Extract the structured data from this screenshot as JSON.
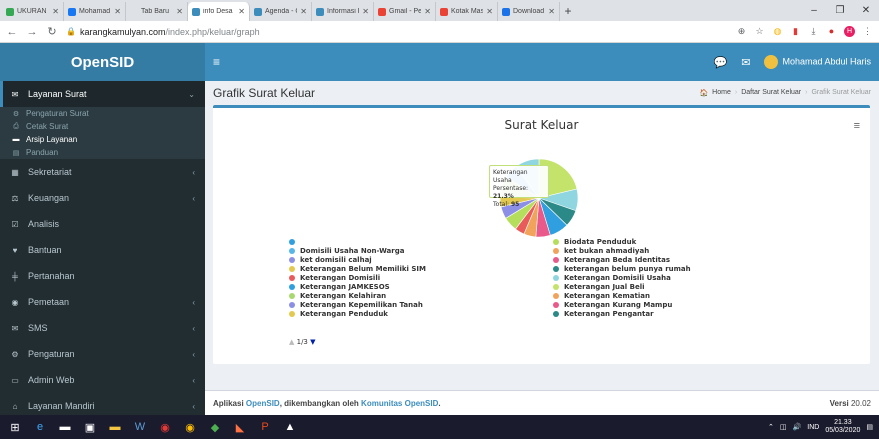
{
  "browser": {
    "tabs": [
      {
        "label": "UKURAN P",
        "color": "#34a853",
        "active": false
      },
      {
        "label": "Mohamad",
        "color": "#1877f2",
        "active": false
      },
      {
        "label": "Tab Baru",
        "color": "#dee1e6",
        "active": false
      },
      {
        "label": "info Desa",
        "color": "#3c8dbc",
        "active": true
      },
      {
        "label": "Agenda - C",
        "color": "#3c8dbc",
        "active": false
      },
      {
        "label": "Informasi P",
        "color": "#3c8dbc",
        "active": false
      },
      {
        "label": "Gmail - Per",
        "color": "#ea4335",
        "active": false
      },
      {
        "label": "Kotak Mas",
        "color": "#ea4335",
        "active": false
      },
      {
        "label": "Download",
        "color": "#1a73e8",
        "active": false
      }
    ],
    "url_host": "karangkamulyan.com",
    "url_path": "/index.php/keluar/graph"
  },
  "app": {
    "logo": "OpenSID",
    "user_name": "Mohamad Abdul Haris"
  },
  "sidebar": {
    "items": [
      {
        "label": "Layanan Surat",
        "icon": "envelope-icon",
        "glyph": "✉",
        "active": true,
        "chevron": "⌄"
      },
      {
        "label": "Sekretariat",
        "icon": "archive-icon",
        "glyph": "▦",
        "chevron": "‹"
      },
      {
        "label": "Keuangan",
        "icon": "balance-icon",
        "glyph": "⚖",
        "chevron": "‹"
      },
      {
        "label": "Analisis",
        "icon": "chart-icon",
        "glyph": "☑",
        "chevron": ""
      },
      {
        "label": "Bantuan",
        "icon": "heart-icon",
        "glyph": "♥",
        "chevron": ""
      },
      {
        "label": "Pertanahan",
        "icon": "land-icon",
        "glyph": "╪",
        "chevron": ""
      },
      {
        "label": "Pemetaan",
        "icon": "globe-icon",
        "glyph": "◉",
        "chevron": "‹"
      },
      {
        "label": "SMS",
        "icon": "sms-icon",
        "glyph": "✉",
        "chevron": "‹"
      },
      {
        "label": "Pengaturan",
        "icon": "users-icon",
        "glyph": "⚙",
        "chevron": "‹"
      },
      {
        "label": "Admin Web",
        "icon": "desktop-icon",
        "glyph": "▭",
        "chevron": "‹"
      },
      {
        "label": "Layanan Mandiri",
        "icon": "laptop-icon",
        "glyph": "⌂",
        "chevron": "‹"
      }
    ],
    "subitems": [
      {
        "label": "Pengaturan Surat",
        "glyph": "⚙",
        "active": false
      },
      {
        "label": "Cetak Surat",
        "glyph": "⎙",
        "active": false
      },
      {
        "label": "Arsip Layanan",
        "glyph": "▬",
        "active": true
      },
      {
        "label": "Panduan",
        "glyph": "▤",
        "active": false
      }
    ]
  },
  "content": {
    "title": "Grafik Surat Keluar",
    "breadcrumb": [
      "Home",
      "Daftar Surat Keluar",
      "Grafik Surat Keluar"
    ]
  },
  "tooltip": {
    "name": "Keterangan Usaha",
    "pct_label": "Persentase: ",
    "pct": "21.3%",
    "total_label": "Total: ",
    "total": "95"
  },
  "pager": {
    "text": "1/3"
  },
  "footer": {
    "prefix": "Aplikasi ",
    "app": "OpenSID",
    "middle": ", dikembangkan oleh ",
    "community": "Komunitas OpenSID",
    "suffix": ".",
    "version_label": "Versi ",
    "version": "20.02"
  },
  "taskbar": {
    "lang": "IND",
    "time": "21.33",
    "date": "05/03/2020"
  },
  "chart_data": {
    "type": "pie",
    "title": "Surat Keluar",
    "legend_left": [
      {
        "name": "",
        "color": "#2f9fe0"
      },
      {
        "name": "Domisili Usaha Non-Warga",
        "color": "#56b6e9"
      },
      {
        "name": "ket domisili calhaj",
        "color": "#8b8fe6"
      },
      {
        "name": "Keterangan Belum Memiliki SIM",
        "color": "#e3c94f"
      },
      {
        "name": "Keterangan Domisili",
        "color": "#e95a5a"
      },
      {
        "name": "Keterangan JAMKESOS",
        "color": "#2f9fe0"
      },
      {
        "name": "Keterangan Kelahiran",
        "color": "#a8d86e"
      },
      {
        "name": "Keterangan Kepemilikan Tanah",
        "color": "#8b8fe6"
      },
      {
        "name": "Keterangan Penduduk",
        "color": "#e3c94f"
      }
    ],
    "legend_right": [
      {
        "name": "Biodata Penduduk",
        "color": "#b5de5c"
      },
      {
        "name": "ket bukan ahmadiyah",
        "color": "#f1a35b"
      },
      {
        "name": "Keterangan Beda Identitas",
        "color": "#e95a8a"
      },
      {
        "name": "keterangan belum punya rumah",
        "color": "#2b8a88"
      },
      {
        "name": "Keterangan Domisili Usaha",
        "color": "#8fd6e0"
      },
      {
        "name": "Keterangan Jual Beli",
        "color": "#c3e36a"
      },
      {
        "name": "Keterangan Kematian",
        "color": "#f1a35b"
      },
      {
        "name": "Keterangan Kurang Mampu",
        "color": "#e95a8a"
      },
      {
        "name": "Keterangan Pengantar",
        "color": "#2b8a88"
      }
    ],
    "slices": [
      {
        "value": 21.3,
        "color": "#c3e36a"
      },
      {
        "value": 9,
        "color": "#8fd6e0"
      },
      {
        "value": 7,
        "color": "#2b8a88"
      },
      {
        "value": 8,
        "color": "#2f9fe0"
      },
      {
        "value": 6,
        "color": "#e95a8a"
      },
      {
        "value": 5,
        "color": "#f1a35b"
      },
      {
        "value": 4,
        "color": "#e95a5a"
      },
      {
        "value": 6,
        "color": "#b5de5c"
      },
      {
        "value": 5,
        "color": "#8b8fe6"
      },
      {
        "value": 4,
        "color": "#e3c94f"
      },
      {
        "value": 8.7,
        "color": "#a8d86e"
      },
      {
        "value": 6,
        "color": "#56b6e9"
      },
      {
        "value": 10,
        "color": "#8fd6e0"
      }
    ]
  }
}
